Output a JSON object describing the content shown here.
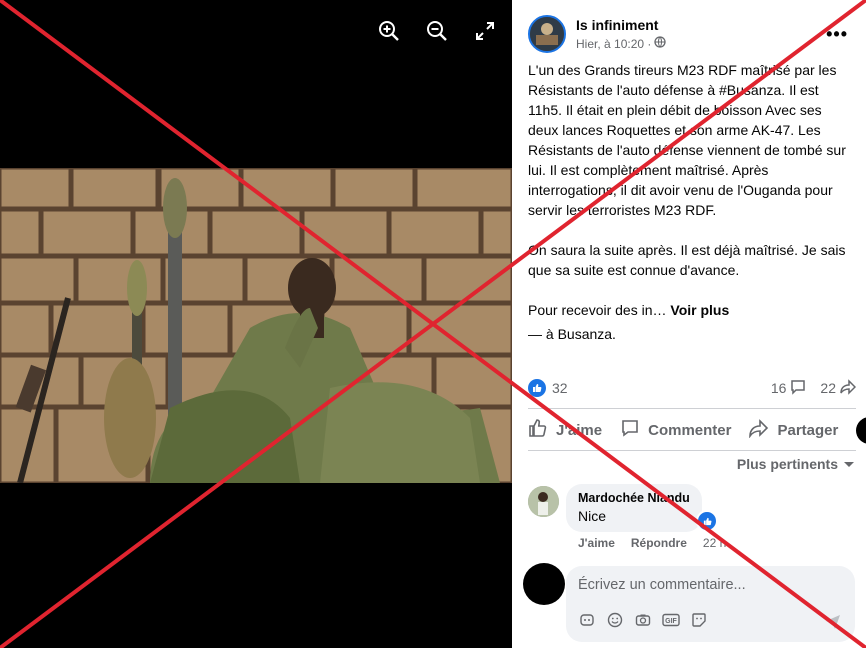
{
  "viewer": {
    "tools": [
      {
        "icon": "zoom-in-icon"
      },
      {
        "icon": "zoom-out-icon"
      },
      {
        "icon": "fullscreen-icon"
      }
    ]
  },
  "post": {
    "author": "Is infiniment",
    "time": "Hier, à 10:20 ·",
    "privacy_icon": "globe-icon",
    "paragraph1": "L'un des Grands tireurs M23 RDF maîtrisé par les Résistants de l'auto défense à #Busanza. Il est 11h5. Il était en plein débit de boisson Avec ses deux lances Roquettes et son arme AK-47. Les Résistants de l'auto défense viennent de tombé sur lui. Il est complètement maîtrisé. Après interrogations, il dit avoir venu de l'Ouganda pour servir les terroristes M23 RDF.",
    "paragraph2": "On saura la suite après. Il est déjà maîtrisé. Je sais que sa suite est connue d'avance.",
    "paragraph3": "Pour recevoir des in…",
    "see_more": "Voir plus",
    "location_prefix": "— à",
    "location": "Busanza."
  },
  "stats": {
    "likes": "32",
    "comments": "16",
    "shares": "22"
  },
  "actions": {
    "like": "J'aime",
    "comment": "Commenter",
    "share": "Partager"
  },
  "sort_label": "Plus pertinents",
  "comment": {
    "author": "Mardochée Niandu",
    "text": "Nice",
    "like": "J'aime",
    "reply": "Répondre",
    "time": "22 h"
  },
  "composer": {
    "placeholder": "Écrivez un commentaire..."
  },
  "colors": {
    "accent": "#1b74e4",
    "cross": "#e0242f"
  }
}
